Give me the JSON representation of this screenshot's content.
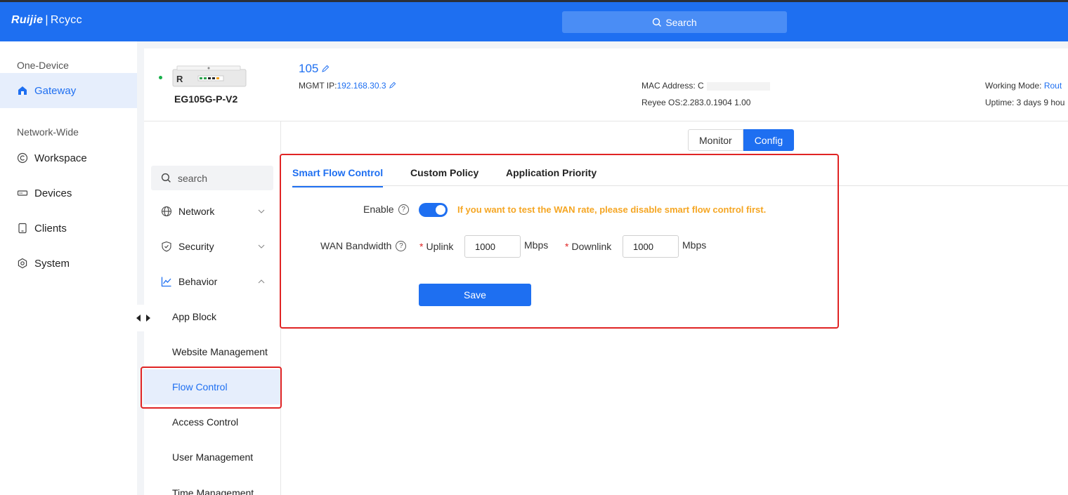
{
  "header": {
    "brand": "Ruijie",
    "brand_sub": "Rcycc",
    "search_label": "Search"
  },
  "leftnav": {
    "section_one": "One-Device",
    "gateway": "Gateway",
    "section_two": "Network-Wide",
    "workspace": "Workspace",
    "devices": "Devices",
    "clients": "Clients",
    "system": "System"
  },
  "device": {
    "name": "105",
    "model": "EG105G-P-V2",
    "image_label": "R",
    "mgmt_label": "MGMT IP:",
    "mgmt_ip": "192.168.30.3",
    "mac_label": "MAC Address: C",
    "os": "Reyee OS:2.283.0.1904 1.00",
    "working_mode_label": "Working Mode: ",
    "working_mode": "Rout",
    "uptime": "Uptime: 3 days 9 hou"
  },
  "mode": {
    "monitor": "Monitor",
    "config": "Config"
  },
  "submenu": {
    "search_placeholder": "search",
    "network": "Network",
    "security": "Security",
    "behavior": "Behavior",
    "app_block": "App Block",
    "website_management": "Website Management",
    "flow_control": "Flow Control",
    "access_control": "Access Control",
    "user_management": "User Management",
    "time_management": "Time Management"
  },
  "tabs": {
    "smart_flow_control": "Smart Flow Control",
    "custom_policy": "Custom Policy",
    "application_priority": "Application Priority"
  },
  "form": {
    "enable_label": "Enable",
    "enable_on": true,
    "warning": "If you want to test the WAN rate, please disable smart flow control first.",
    "wan_bandwidth_label": "WAN Bandwidth",
    "required_mark": "*",
    "uplink_label": "Uplink",
    "uplink_value": "1000",
    "uplink_unit": "Mbps",
    "downlink_label": "Downlink",
    "downlink_value": "1000",
    "downlink_unit": "Mbps",
    "save_label": "Save"
  },
  "colors": {
    "accent": "#1e6ff1",
    "warning": "#f5a623",
    "highlight": "#e02424"
  }
}
